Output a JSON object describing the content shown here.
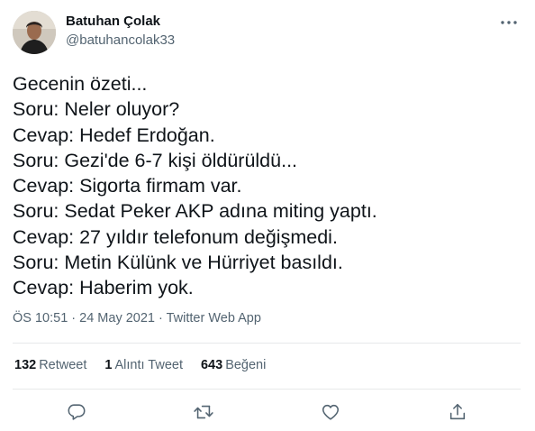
{
  "author": {
    "display_name": "Batuhan Çolak",
    "handle": "@batuhancolak33"
  },
  "more_icon": "ellipsis-icon",
  "tweet": {
    "lines": [
      "Gecenin özeti...",
      "Soru: Neler oluyor?",
      "Cevap: Hedef Erdoğan.",
      "Soru: Gezi'de 6-7 kişi öldürüldü...",
      "Cevap: Sigorta firmam var.",
      "Soru: Sedat Peker AKP adına miting yaptı.",
      "Cevap: 27 yıldır telefonum değişmedi.",
      "Soru: Metin Külünk ve Hürriyet basıldı.",
      "Cevap: Haberim yok."
    ],
    "meta": "ÖS 10:51 · 24 May 2021 · Twitter Web App"
  },
  "stats": {
    "retweets": {
      "count": "132",
      "label": "Retweet"
    },
    "quotes": {
      "count": "1",
      "label": "Alıntı Tweet"
    },
    "likes": {
      "count": "643",
      "label": "Beğeni"
    }
  },
  "actions": [
    "reply-icon",
    "retweet-icon",
    "like-icon",
    "share-icon"
  ],
  "colors": {
    "text": "#0f1419",
    "secondary": "#536471",
    "divider": "#e7e9ea"
  }
}
